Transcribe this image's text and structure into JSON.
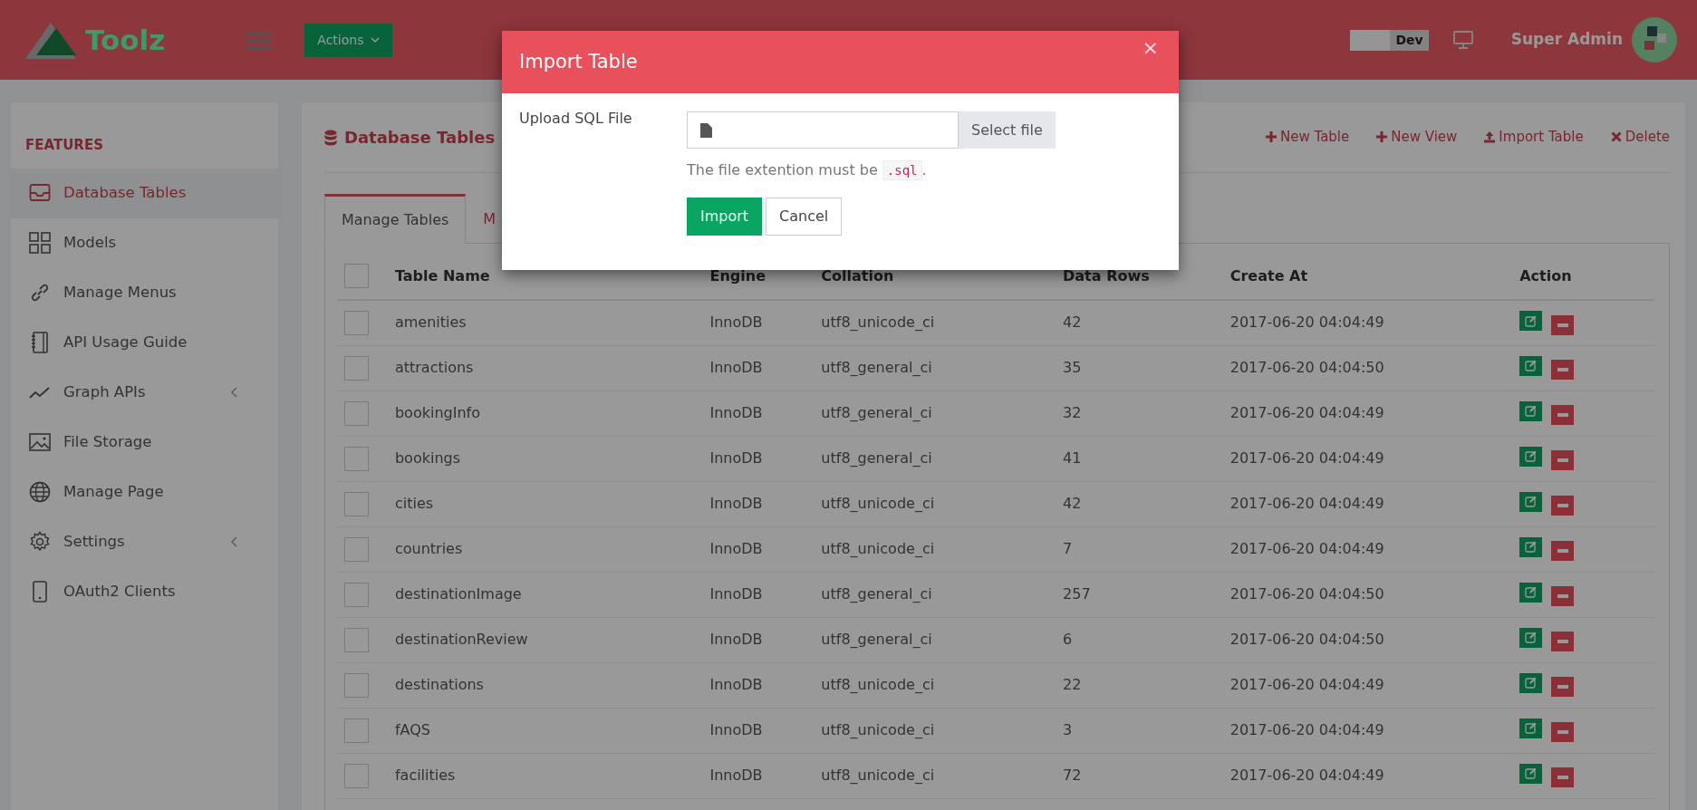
{
  "header": {
    "logo_text": "Toolz",
    "actions_button": "Actions",
    "env_switch": {
      "label": "Dev",
      "on": true
    },
    "user_name": "Super Admin"
  },
  "sidebar": {
    "section_title": "FEATURES",
    "items": [
      {
        "label": "Database Tables",
        "selected": true,
        "has_submenu": false
      },
      {
        "label": "Models",
        "selected": false,
        "has_submenu": false
      },
      {
        "label": "Manage Menus",
        "selected": false,
        "has_submenu": false
      },
      {
        "label": "API Usage Guide",
        "selected": false,
        "has_submenu": false
      },
      {
        "label": "Graph APIs",
        "selected": false,
        "has_submenu": true
      },
      {
        "label": "File Storage",
        "selected": false,
        "has_submenu": false
      },
      {
        "label": "Manage Page",
        "selected": false,
        "has_submenu": false
      },
      {
        "label": "Settings",
        "selected": false,
        "has_submenu": true
      },
      {
        "label": "OAuth2 Clients",
        "selected": false,
        "has_submenu": false
      }
    ]
  },
  "page": {
    "title": "Database Tables",
    "toolbar": [
      "New Table",
      "New View",
      "Import Table",
      "Delete"
    ],
    "tabs": [
      {
        "label": "Manage Tables",
        "selected": true
      },
      {
        "label": "M",
        "selected": false
      }
    ],
    "table": {
      "select_all_checked": false,
      "columns": [
        "Table Name",
        "Engine",
        "Collation",
        "Data Rows",
        "Create At",
        "Action"
      ],
      "rows": [
        {
          "name": "amenities",
          "engine": "InnoDB",
          "collation": "utf8_unicode_ci",
          "data_rows": "42",
          "created_at": "2017-06-20 04:04:49",
          "checked": false
        },
        {
          "name": "attractions",
          "engine": "InnoDB",
          "collation": "utf8_general_ci",
          "data_rows": "35",
          "created_at": "2017-06-20 04:04:50",
          "checked": false
        },
        {
          "name": "bookingInfo",
          "engine": "InnoDB",
          "collation": "utf8_general_ci",
          "data_rows": "32",
          "created_at": "2017-06-20 04:04:49",
          "checked": false
        },
        {
          "name": "bookings",
          "engine": "InnoDB",
          "collation": "utf8_general_ci",
          "data_rows": "41",
          "created_at": "2017-06-20 04:04:49",
          "checked": false
        },
        {
          "name": "cities",
          "engine": "InnoDB",
          "collation": "utf8_unicode_ci",
          "data_rows": "42",
          "created_at": "2017-06-20 04:04:49",
          "checked": false
        },
        {
          "name": "countries",
          "engine": "InnoDB",
          "collation": "utf8_unicode_ci",
          "data_rows": "7",
          "created_at": "2017-06-20 04:04:49",
          "checked": false
        },
        {
          "name": "destinationImage",
          "engine": "InnoDB",
          "collation": "utf8_general_ci",
          "data_rows": "257",
          "created_at": "2017-06-20 04:04:50",
          "checked": false
        },
        {
          "name": "destinationReview",
          "engine": "InnoDB",
          "collation": "utf8_general_ci",
          "data_rows": "6",
          "created_at": "2017-06-20 04:04:50",
          "checked": false
        },
        {
          "name": "destinations",
          "engine": "InnoDB",
          "collation": "utf8_unicode_ci",
          "data_rows": "22",
          "created_at": "2017-06-20 04:04:49",
          "checked": false
        },
        {
          "name": "fAQS",
          "engine": "InnoDB",
          "collation": "utf8_unicode_ci",
          "data_rows": "3",
          "created_at": "2017-06-20 04:04:49",
          "checked": false
        },
        {
          "name": "facilities",
          "engine": "InnoDB",
          "collation": "utf8_unicode_ci",
          "data_rows": "72",
          "created_at": "2017-06-20 04:04:49",
          "checked": false
        }
      ]
    }
  },
  "modal": {
    "title": "Import Table",
    "close": "×",
    "field_label": "Upload SQL File",
    "select_button": "Select file",
    "help_before": "The file extention must be ",
    "help_code": ".sql",
    "help_after": ".",
    "buttons": [
      {
        "label": "Import",
        "kind": "primary"
      },
      {
        "label": "Cancel",
        "kind": "secondary"
      }
    ]
  }
}
